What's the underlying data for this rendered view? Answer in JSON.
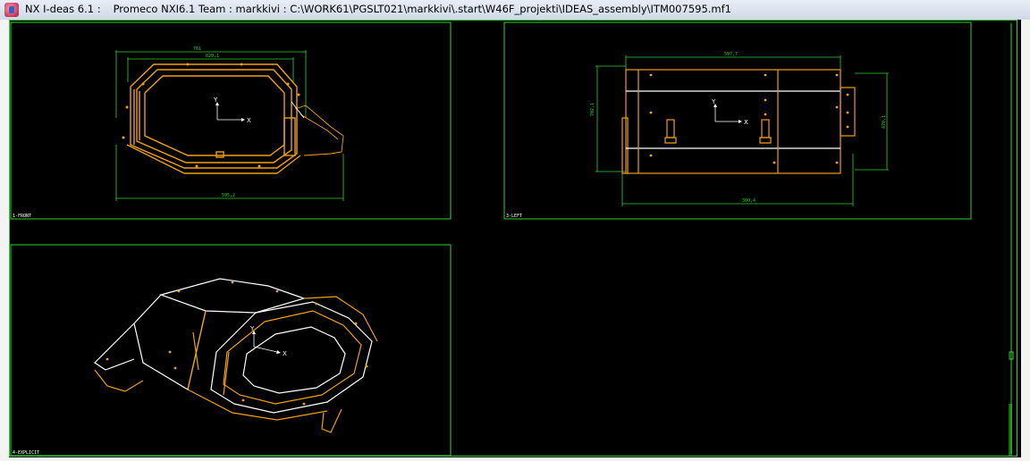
{
  "window": {
    "app": "NX I-deas 6.1 :",
    "team": "Promeco NXI6.1 Team : markkivi : C:\\WORK61\\PGSLT021\\markkivi\\.start\\W46F_projekti\\IDEAS_assembly\\ITM007595.mf1"
  },
  "views": {
    "front": {
      "label": "1-FRONT",
      "dim_top_outer": "761",
      "dim_top_inner": "629,1",
      "dim_bottom": "595,2",
      "axis_x": "X",
      "axis_y": "Y"
    },
    "left": {
      "label": "3-LEFT",
      "dim_top": "597,7",
      "dim_left": "702,1",
      "dim_right": "470,1",
      "dim_bottom": "300,4",
      "axis_x": "X",
      "axis_y": "Y"
    },
    "explicit": {
      "label": "4-EXPLICIT",
      "axis_x": "X",
      "axis_y": "Y"
    }
  },
  "colors": {
    "background": "#000000",
    "view_border": "#2fd22f",
    "geometry": "#f0a010",
    "geometry_white": "#ffffff",
    "titlebar": "#dbe4f0"
  }
}
